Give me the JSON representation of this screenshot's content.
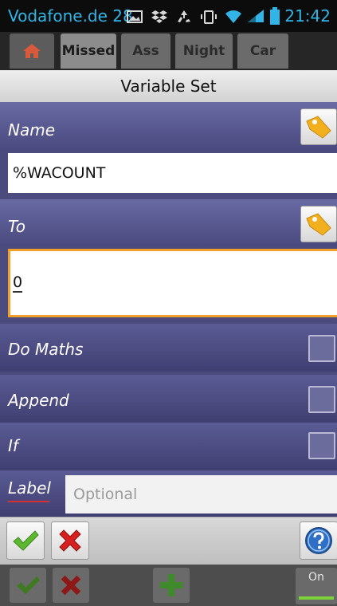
{
  "status_bar": {
    "carrier": "Vodafone.de 28",
    "time": "21:42",
    "icons": [
      "image-icon",
      "dropbox-icon",
      "recycle-icon",
      "vibrate-icon",
      "wifi-icon",
      "signal-icon",
      "battery-icon"
    ]
  },
  "tabs": {
    "items": [
      {
        "label": "",
        "icon": "home-icon"
      },
      {
        "label": "Missed"
      },
      {
        "label": "Ass"
      },
      {
        "label": "Night"
      },
      {
        "label": "Car"
      }
    ],
    "selected": "Missed"
  },
  "dialog": {
    "title": "Variable Set",
    "name": {
      "label": "Name",
      "value": "%WACOUNT"
    },
    "to": {
      "label": "To",
      "value": "0"
    },
    "do_maths": {
      "label": "Do Maths",
      "checked": false
    },
    "append": {
      "label": "Append",
      "checked": false
    },
    "if": {
      "label": "If",
      "checked": false
    },
    "task_label": {
      "label": "Label",
      "placeholder": "Optional",
      "value": ""
    }
  },
  "buttons": {
    "accept_icon": "checkmark-icon",
    "cancel_icon": "close-x-icon",
    "help_icon": "help-icon"
  },
  "bottom_bar": {
    "toggle_label": "On",
    "add_icon": "plus-icon"
  },
  "colors": {
    "dialog_bg": "#4b4b7e",
    "focus_border": "#f0a02a",
    "status_accent": "#32b4e6",
    "check_green": "#5cb82e",
    "cancel_red": "#d62020"
  }
}
